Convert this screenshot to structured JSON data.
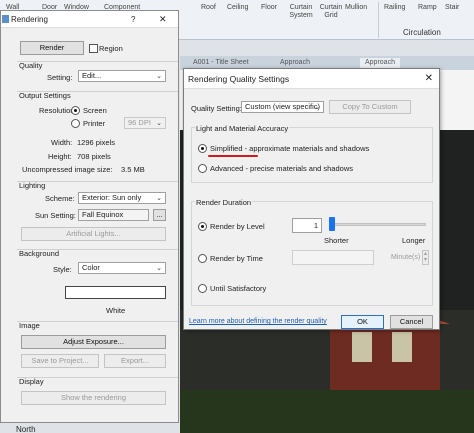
{
  "ribbon": {
    "items": [
      "Wall",
      "Door",
      "Window",
      "Component",
      "Roof",
      "Ceiling",
      "Floor",
      "Curtain System",
      "Curtain Grid",
      "Mullion",
      "Railing",
      "Ramp",
      "Stair"
    ],
    "panel_label": "Circulation"
  },
  "doc_tabs": [
    "A001 - Title Sheet",
    "Approach",
    "Approach"
  ],
  "viewport": {
    "compass_label": "North"
  },
  "render_dialog": {
    "title": "Rendering",
    "help": "?",
    "close": "✕",
    "render_button": "Render",
    "region_label": "Region",
    "quality": {
      "group_label": "Quality",
      "setting_label": "Setting:",
      "setting_value": "Edit..."
    },
    "output": {
      "group_label": "Output Settings",
      "resolution_label": "Resolution:",
      "screen_label": "Screen",
      "printer_label": "Printer",
      "dpi_value": "96 DPI",
      "width_label": "Width:",
      "width_value": "1296 pixels",
      "height_label": "Height:",
      "height_value": "708 pixels",
      "size_label": "Uncompressed image size:",
      "size_value": "3.5 MB"
    },
    "lighting": {
      "group_label": "Lighting",
      "scheme_label": "Scheme:",
      "scheme_value": "Exterior: Sun only",
      "sun_label": "Sun Setting:",
      "sun_value": "Fall Equinox",
      "browse": "...",
      "artificial_button": "Artificial Lights..."
    },
    "background": {
      "group_label": "Background",
      "style_label": "Style:",
      "style_value": "Color",
      "color_name": "White",
      "color_hex": "#ffffff"
    },
    "image": {
      "group_label": "Image",
      "adjust_button": "Adjust Exposure...",
      "save_button": "Save to Project...",
      "export_button": "Export..."
    },
    "display": {
      "group_label": "Display",
      "show_button": "Show the rendering"
    }
  },
  "quality_dialog": {
    "title": "Rendering Quality Settings",
    "close": "✕",
    "quality_setting_label": "Quality Setting:",
    "quality_setting_value": "Custom (view specific)",
    "copy_button": "Copy To Custom",
    "accuracy": {
      "group_label": "Light and Material Accuracy",
      "simplified_label": "Simplified - approximate materials and shadows",
      "advanced_label": "Advanced - precise materials and shadows",
      "selected": "simplified"
    },
    "duration": {
      "group_label": "Render Duration",
      "by_level_label": "Render by Level",
      "level_value": "1",
      "level_fraction": 0.0,
      "shorter_label": "Shorter",
      "longer_label": "Longer",
      "by_time_label": "Render by Time",
      "time_unit": "Minute(s)",
      "until_label": "Until Satisfactory",
      "selected": "by_level"
    },
    "learn_more_link": "Learn more about defining the render quality",
    "ok_button": "OK",
    "cancel_button": "Cancel"
  },
  "colors": {
    "accent": "#1a73e8",
    "underline": "#d21a1a",
    "link": "#1a5fb4"
  }
}
